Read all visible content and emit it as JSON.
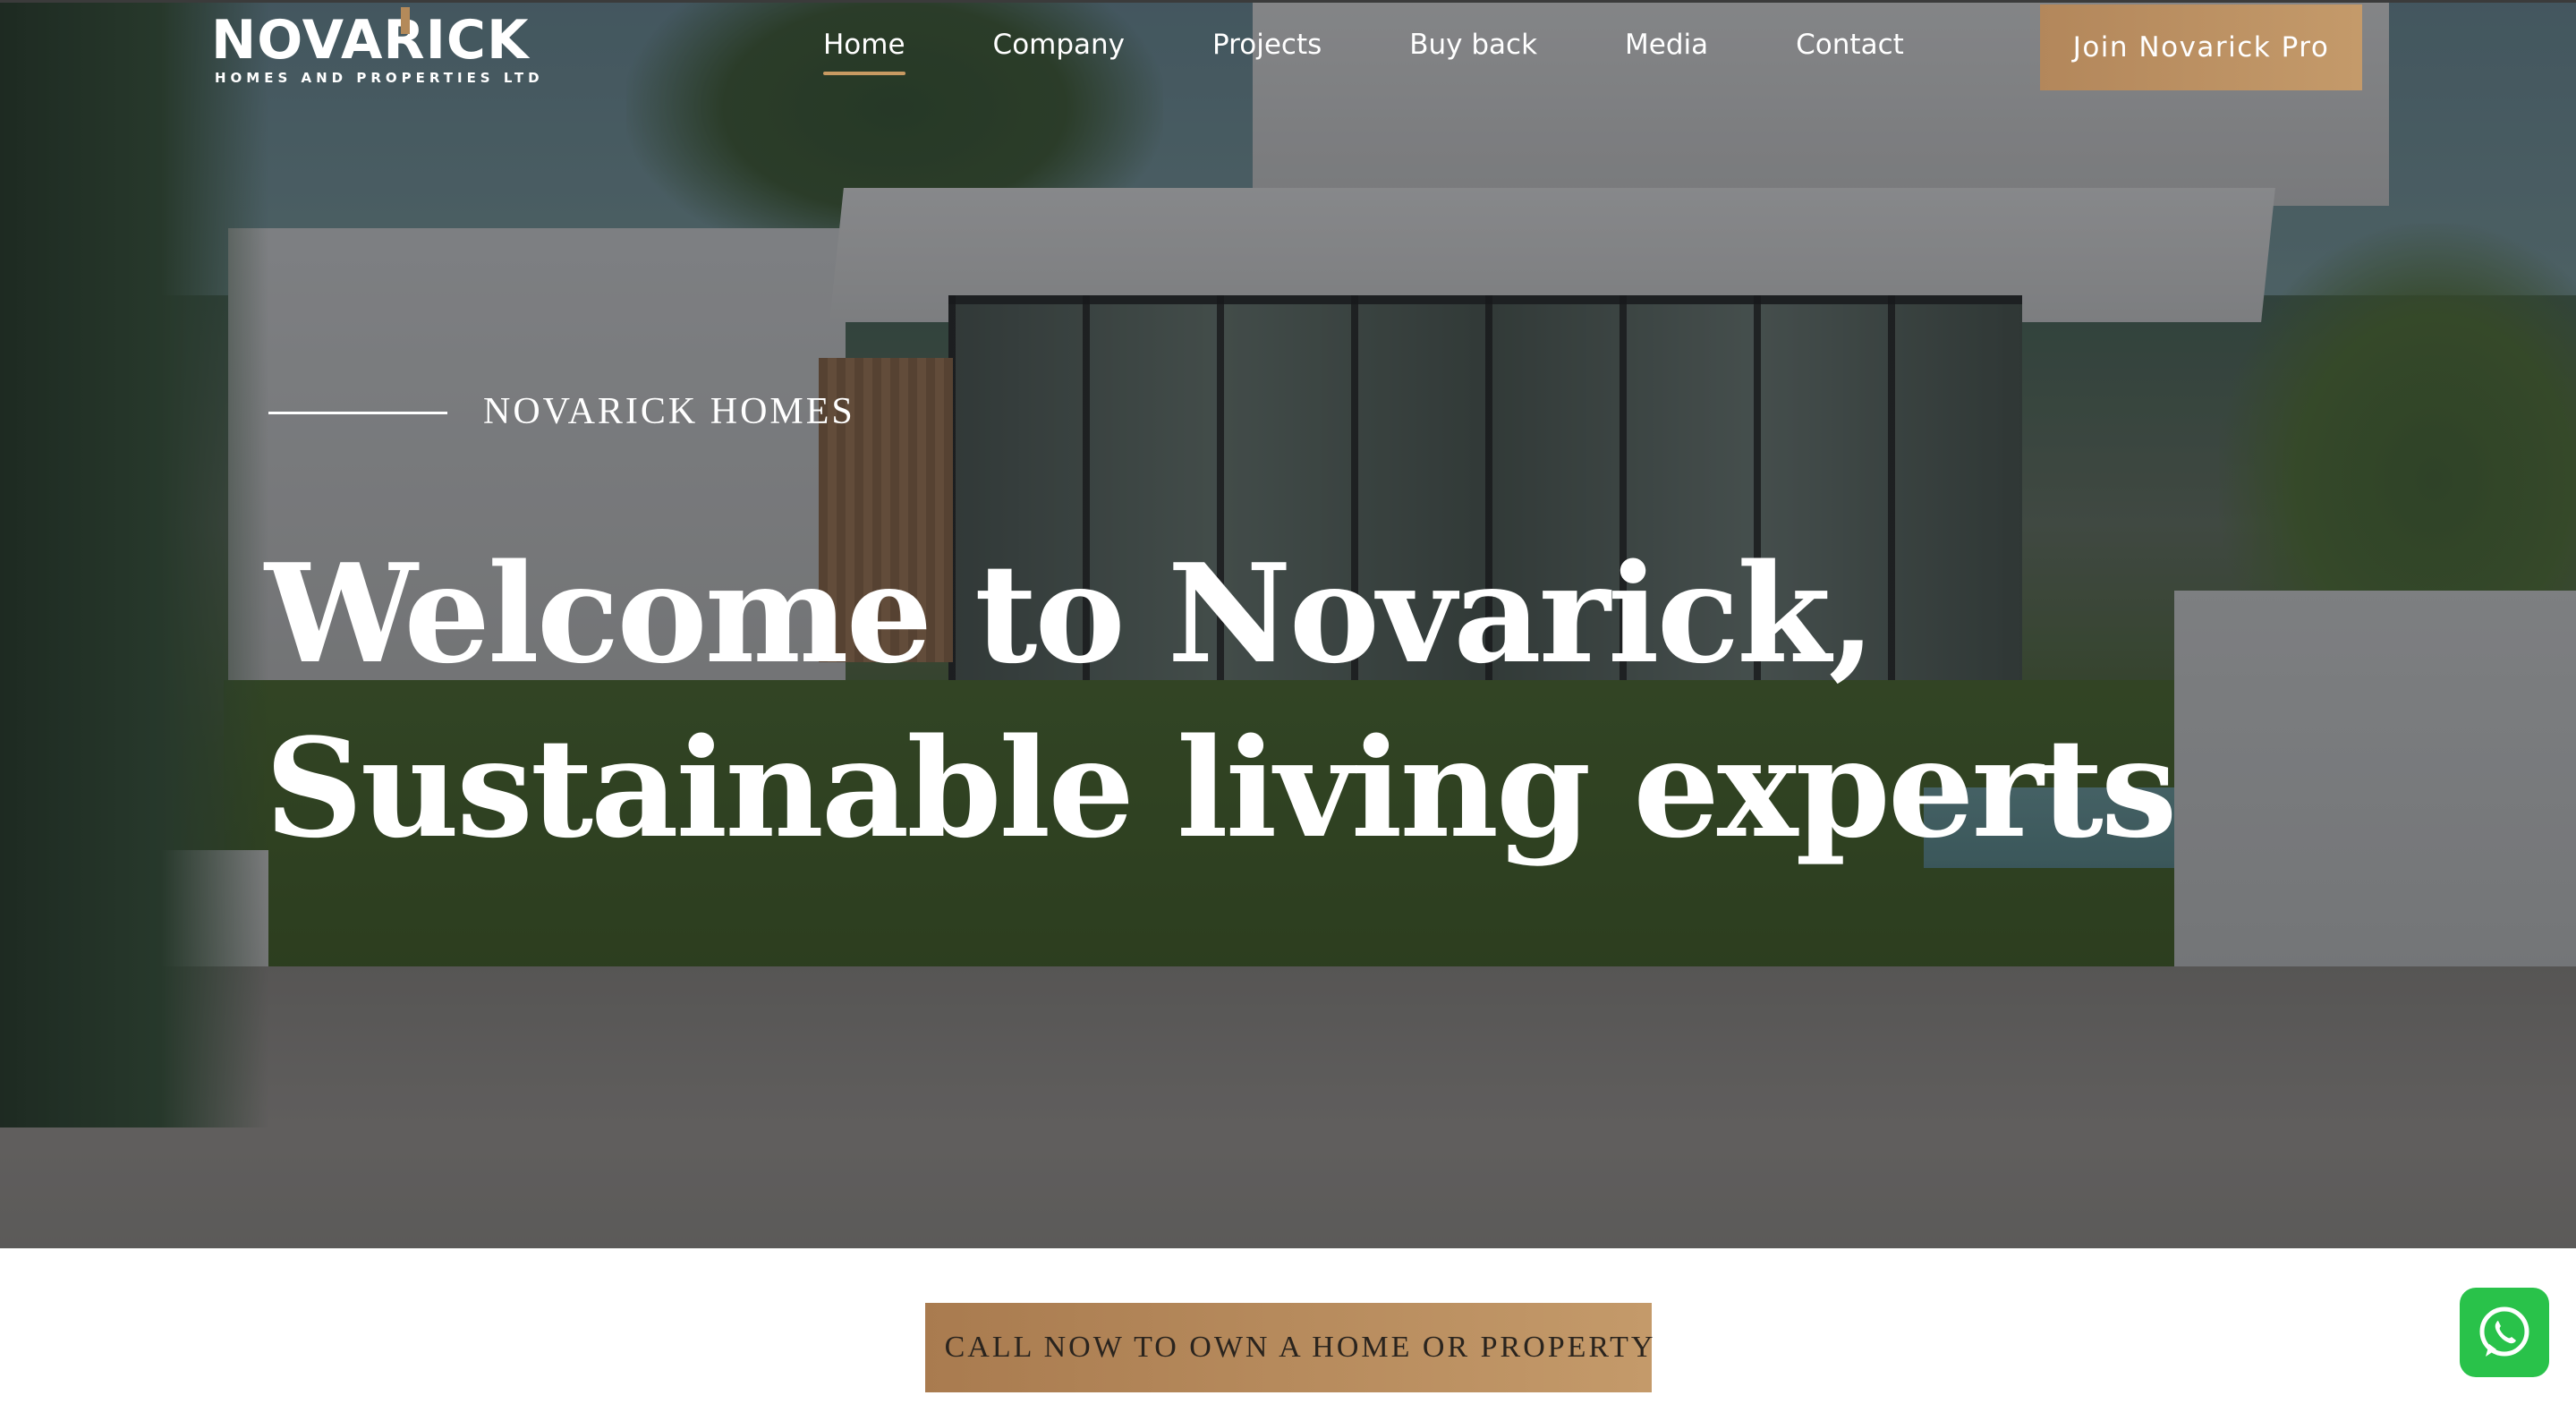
{
  "brand": {
    "name": "NOVARICK",
    "tagline": "HOMES AND PROPERTIES LTD",
    "accent_color": "#c49a6a"
  },
  "nav": {
    "items": [
      {
        "label": "Home",
        "active": true
      },
      {
        "label": "Company",
        "active": false
      },
      {
        "label": "Projects",
        "active": false
      },
      {
        "label": "Buy back",
        "active": false
      },
      {
        "label": "Media",
        "active": false
      },
      {
        "label": "Contact",
        "active": false
      }
    ],
    "cta_label": "Join Novarick Pro"
  },
  "hero": {
    "eyebrow": "NOVARICK HOMES",
    "headline_line1": "Welcome to Novarick,",
    "headline_line2": "Sustainable living experts"
  },
  "call_to_action": {
    "label": "CALL NOW TO OWN A HOME OR PROPERTY",
    "icon": "phone-icon"
  },
  "floating": {
    "whatsapp_icon": "whatsapp-icon",
    "whatsapp_color": "#29c24a"
  }
}
